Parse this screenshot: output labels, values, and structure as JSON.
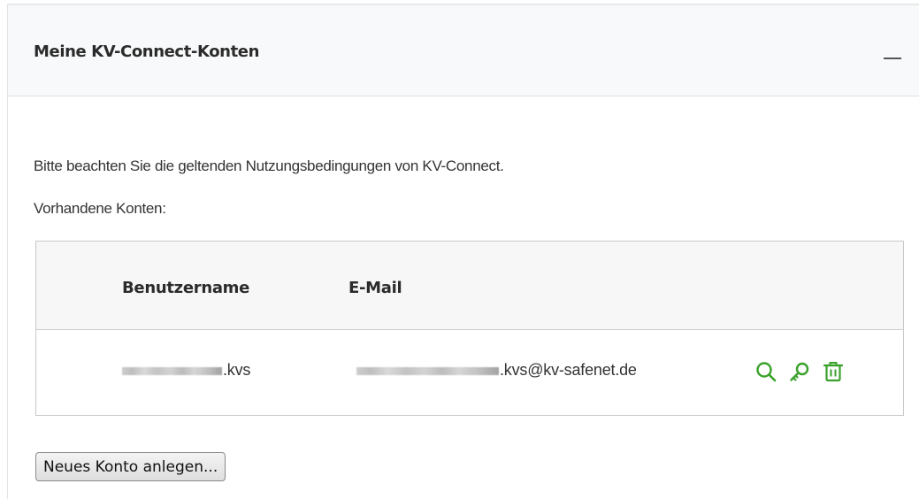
{
  "panel": {
    "title": "Meine KV-Connect-Konten",
    "collapse_icon": "minus-icon"
  },
  "notice": "Bitte beachten Sie die geltenden Nutzungsbedingungen von KV-Connect.",
  "existing_label": "Vorhandene Konten:",
  "table": {
    "columns": [
      "Benutzername",
      "E-Mail"
    ],
    "rows": [
      {
        "username_suffix": ".kvs",
        "email_suffix": ".kvs@kv-safenet.de",
        "actions": [
          "search-icon",
          "key-icon",
          "trash-icon"
        ]
      }
    ]
  },
  "new_account_button": "Neues Konto anlegen...",
  "colors": {
    "accent_green": "#3aa12b",
    "header_bg": "#f8f9fa"
  }
}
